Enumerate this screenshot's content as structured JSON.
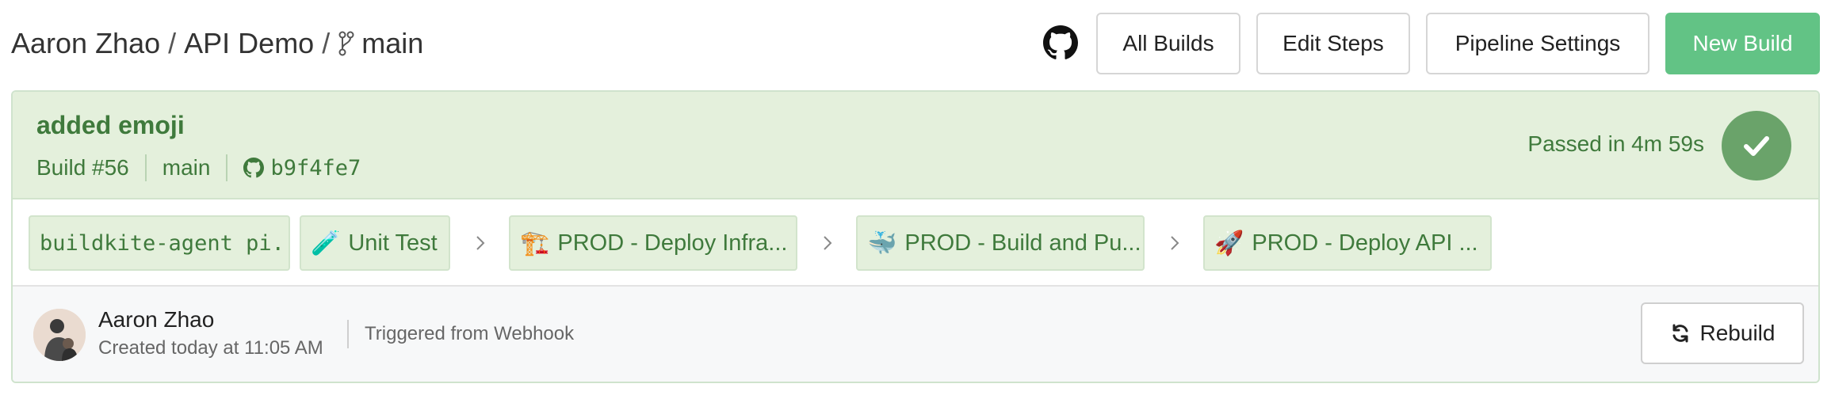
{
  "breadcrumb": {
    "org": "Aaron Zhao",
    "separator": "/",
    "pipeline": "API Demo",
    "branch": "main"
  },
  "header": {
    "github_icon": "github-icon",
    "buttons": {
      "all_builds": "All Builds",
      "edit_steps": "Edit Steps",
      "pipeline_settings": "Pipeline Settings",
      "new_build": "New Build"
    },
    "primary_color": "#62c385"
  },
  "build": {
    "message": "added emoji",
    "number": "Build #56",
    "branch": "main",
    "commit": "b9f4fe7",
    "status_text": "Passed in 4m 59s",
    "status_icon": "checkmark-icon",
    "status_color": "#6aa36a",
    "jobs": [
      {
        "label": "buildkite-agent pi...",
        "emoji": ""
      },
      {
        "label": "Unit Test",
        "emoji": "🧪"
      },
      {
        "label": "PROD - Deploy Infra...",
        "emoji": "🏗️"
      },
      {
        "label": "PROD - Build and Pu...",
        "emoji": "🐳"
      },
      {
        "label": "PROD - Deploy API ...",
        "emoji": "🚀"
      }
    ]
  },
  "footer": {
    "author": "Aaron Zhao",
    "created": "Created today at 11:05 AM",
    "trigger": "Triggered from Webhook",
    "rebuild_label": "Rebuild"
  }
}
